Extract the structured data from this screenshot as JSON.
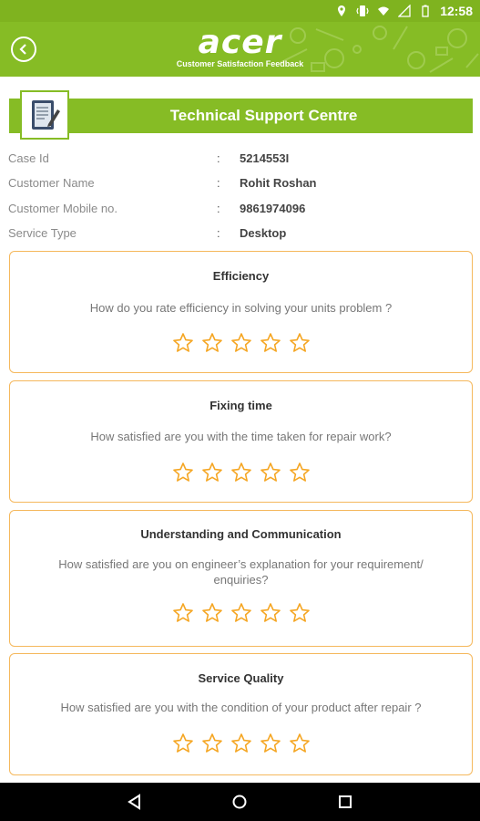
{
  "status_bar": {
    "time": "12:58"
  },
  "header": {
    "logo": "acer",
    "subtitle": "Customer Satisfaction Feedback",
    "accent_color": "#86bc25"
  },
  "banner": {
    "title": "Technical Support Centre"
  },
  "info": [
    {
      "label": "Case Id",
      "colon": ":",
      "value": "5214553I"
    },
    {
      "label": "Customer Name",
      "colon": ":",
      "value": "Rohit Roshan"
    },
    {
      "label": "Customer Mobile no.",
      "colon": ":",
      "value": "9861974096"
    },
    {
      "label": "Service Type",
      "colon": ":",
      "value": "Desktop"
    }
  ],
  "cards": [
    {
      "title": "Efficiency",
      "question": "How do you rate efficiency in solving your units problem ?",
      "rating": 0
    },
    {
      "title": "Fixing time",
      "question": "How satisfied are you with the time taken for repair work?",
      "rating": 0
    },
    {
      "title": "Understanding and Communication",
      "question": "How satisfied are you on engineer’s explanation for your requirement/ enquiries?",
      "rating": 0
    },
    {
      "title": "Service Quality",
      "question": "How  satisfied  are  you with the condition of your product after repair ?",
      "rating": 0
    }
  ],
  "star_color": "#f5a623",
  "nav": {
    "back": "back-icon",
    "home": "home-icon",
    "recents": "recents-icon"
  }
}
